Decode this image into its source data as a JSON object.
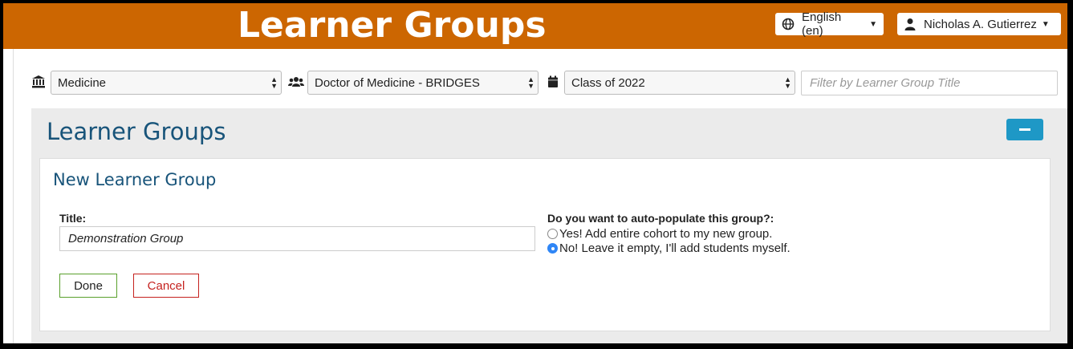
{
  "header": {
    "title": "Learner Groups",
    "language_label": "English (en)",
    "user_name": "Nicholas A. Gutierrez"
  },
  "filters": {
    "school": "Medicine",
    "program": "Doctor of Medicine - BRIDGES",
    "cohort": "Class of 2022",
    "search_placeholder": "Filter by Learner Group Title"
  },
  "panel": {
    "title": "Learner Groups"
  },
  "new_group": {
    "heading": "New Learner Group",
    "title_label": "Title:",
    "title_value": "Demonstration Group",
    "question": "Do you want to auto-populate this group?:",
    "option_yes": "Yes! Add entire cohort to my new group.",
    "option_no": "No! Leave it empty, I'll add students myself.",
    "selected": "no",
    "done_label": "Done",
    "cancel_label": "Cancel"
  },
  "icons": {
    "school": "institution-icon",
    "program": "users-icon",
    "cohort": "calendar-icon",
    "language": "globe-icon",
    "user": "user-icon"
  },
  "colors": {
    "header_bg": "#cc6601",
    "heading": "#18547a",
    "collapse_button": "#1e98c6",
    "done_border": "#5aa02c",
    "cancel": "#c5221f"
  }
}
